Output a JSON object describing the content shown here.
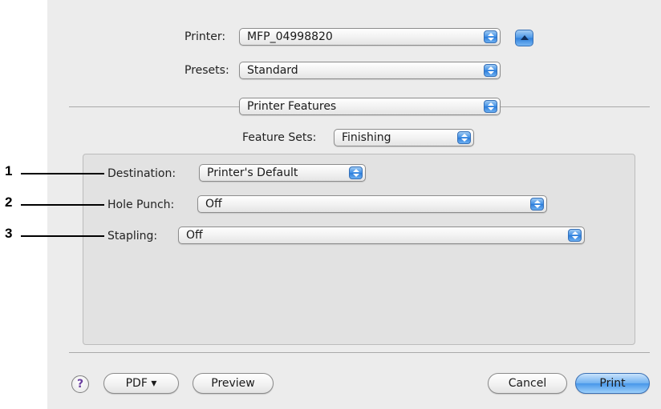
{
  "printer": {
    "label": "Printer:",
    "value": "MFP_04998820"
  },
  "presets": {
    "label": "Presets:",
    "value": "Standard"
  },
  "pane": {
    "value": "Printer Features"
  },
  "feature_sets": {
    "label": "Feature Sets:",
    "value": "Finishing"
  },
  "options": [
    {
      "label": "Destination:",
      "value": "Printer's Default",
      "callout": "1"
    },
    {
      "label": "Hole Punch:",
      "value": "Off",
      "callout": "2"
    },
    {
      "label": "Stapling:",
      "value": "Off",
      "callout": "3"
    }
  ],
  "footer": {
    "help": "?",
    "pdf": "PDF ▾",
    "preview": "Preview",
    "cancel": "Cancel",
    "print": "Print"
  },
  "colors": {
    "accent": "#4897ea",
    "dialog_bg": "#ececec",
    "panel_bg": "#e2e2e2"
  },
  "icons": {
    "popup_arrows": "up-down-arrows-icon",
    "collapse": "triangle-up-icon",
    "help": "question-mark-icon"
  }
}
